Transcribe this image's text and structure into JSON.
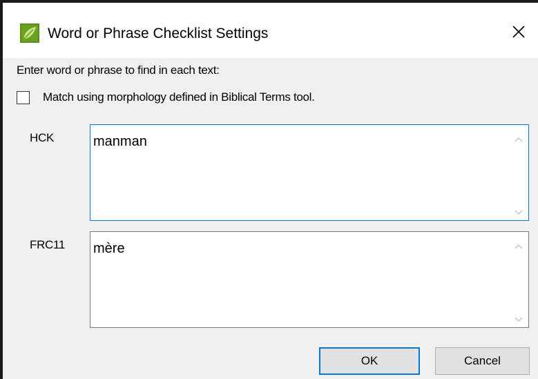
{
  "window": {
    "title": "Word or Phrase Checklist Settings",
    "close_glyph": "✕"
  },
  "dialog": {
    "prompt": "Enter word or phrase to find in each text:",
    "morphology_checkbox": {
      "label": "Match using morphology defined in Biblical Terms tool.",
      "checked": false
    },
    "fields": [
      {
        "label": "HCK",
        "value": "manman",
        "focused": true
      },
      {
        "label": "FRC11",
        "value": "mère",
        "focused": false
      }
    ],
    "ok_label": "OK",
    "cancel_label": "Cancel"
  },
  "colors": {
    "focus_border": "#0078d7",
    "app_icon_green": "#6aa121",
    "dialog_bg": "#f0f0f0"
  },
  "icons": {
    "app": "paratext-green-leaf-icon",
    "close": "close-icon",
    "scroll_up": "chevron-up-icon",
    "scroll_down": "chevron-down-icon"
  }
}
